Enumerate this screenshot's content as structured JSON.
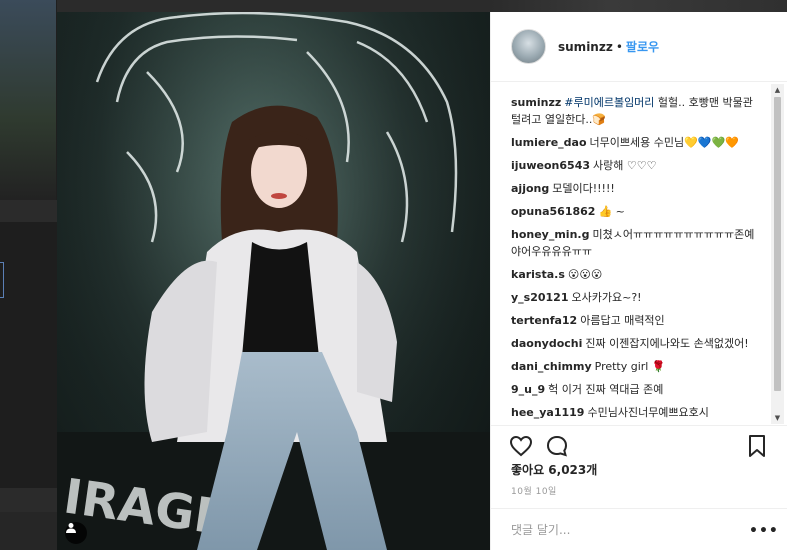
{
  "post": {
    "username": "suminzz",
    "dot": "•",
    "follow_label": "팔로우",
    "likes_text": "좋아요 6,023개",
    "date_text": "10월 10일",
    "add_comment_placeholder": "댓글 달기...",
    "more_label": "•••"
  },
  "comments": [
    {
      "user": "suminzz",
      "hashtag": "#루미에르볼임머리",
      "text": " 헐헐.. 호빵맨 박물관 털려고 열일한다..🍞"
    },
    {
      "user": "lumiere_dao",
      "hashtag": "",
      "text": "너무이쁘세용 수민님💛💙💚🧡"
    },
    {
      "user": "ijuweon6543",
      "hashtag": "",
      "text": "사랑해 ♡♡♡"
    },
    {
      "user": "ajjong",
      "hashtag": "",
      "text": "모델이다!!!!!"
    },
    {
      "user": "opuna561862",
      "hashtag": "",
      "text": "👍 ~"
    },
    {
      "user": "honey_min.g",
      "hashtag": "",
      "text": "미쳤ㅅ어ㅠㅠㅠㅠㅠㅠㅠㅠㅠㅠ존예야어우유유유ㅠㅠ"
    },
    {
      "user": "karista.s",
      "hashtag": "",
      "text": "😮😮😮"
    },
    {
      "user": "y_s20121",
      "hashtag": "",
      "text": "오사카가요~?!"
    },
    {
      "user": "tertenfa12",
      "hashtag": "",
      "text": "아름답고 매력적인"
    },
    {
      "user": "daonydochi",
      "hashtag": "",
      "text": "진짜 이젠잡지에나와도 손색없겠어!"
    },
    {
      "user": "dani_chimmy",
      "hashtag": "",
      "text": "Pretty girl 🌹"
    },
    {
      "user": "9_u_9",
      "hashtag": "",
      "text": "헉 이거 진짜 역대급 존예"
    },
    {
      "user": "hee_ya1119",
      "hashtag": "",
      "text": "수민님사진너무예쁘요호시"
    }
  ],
  "icons": {
    "heart": "heart-icon",
    "comment": "comment-bubble-icon",
    "bookmark": "bookmark-icon",
    "user_tag": "user-tag-icon",
    "scroll_up": "▲",
    "scroll_down": "▼"
  },
  "colors": {
    "link": "#3897f0",
    "hashtag": "#003569",
    "text": "#262626",
    "muted": "#999999"
  }
}
